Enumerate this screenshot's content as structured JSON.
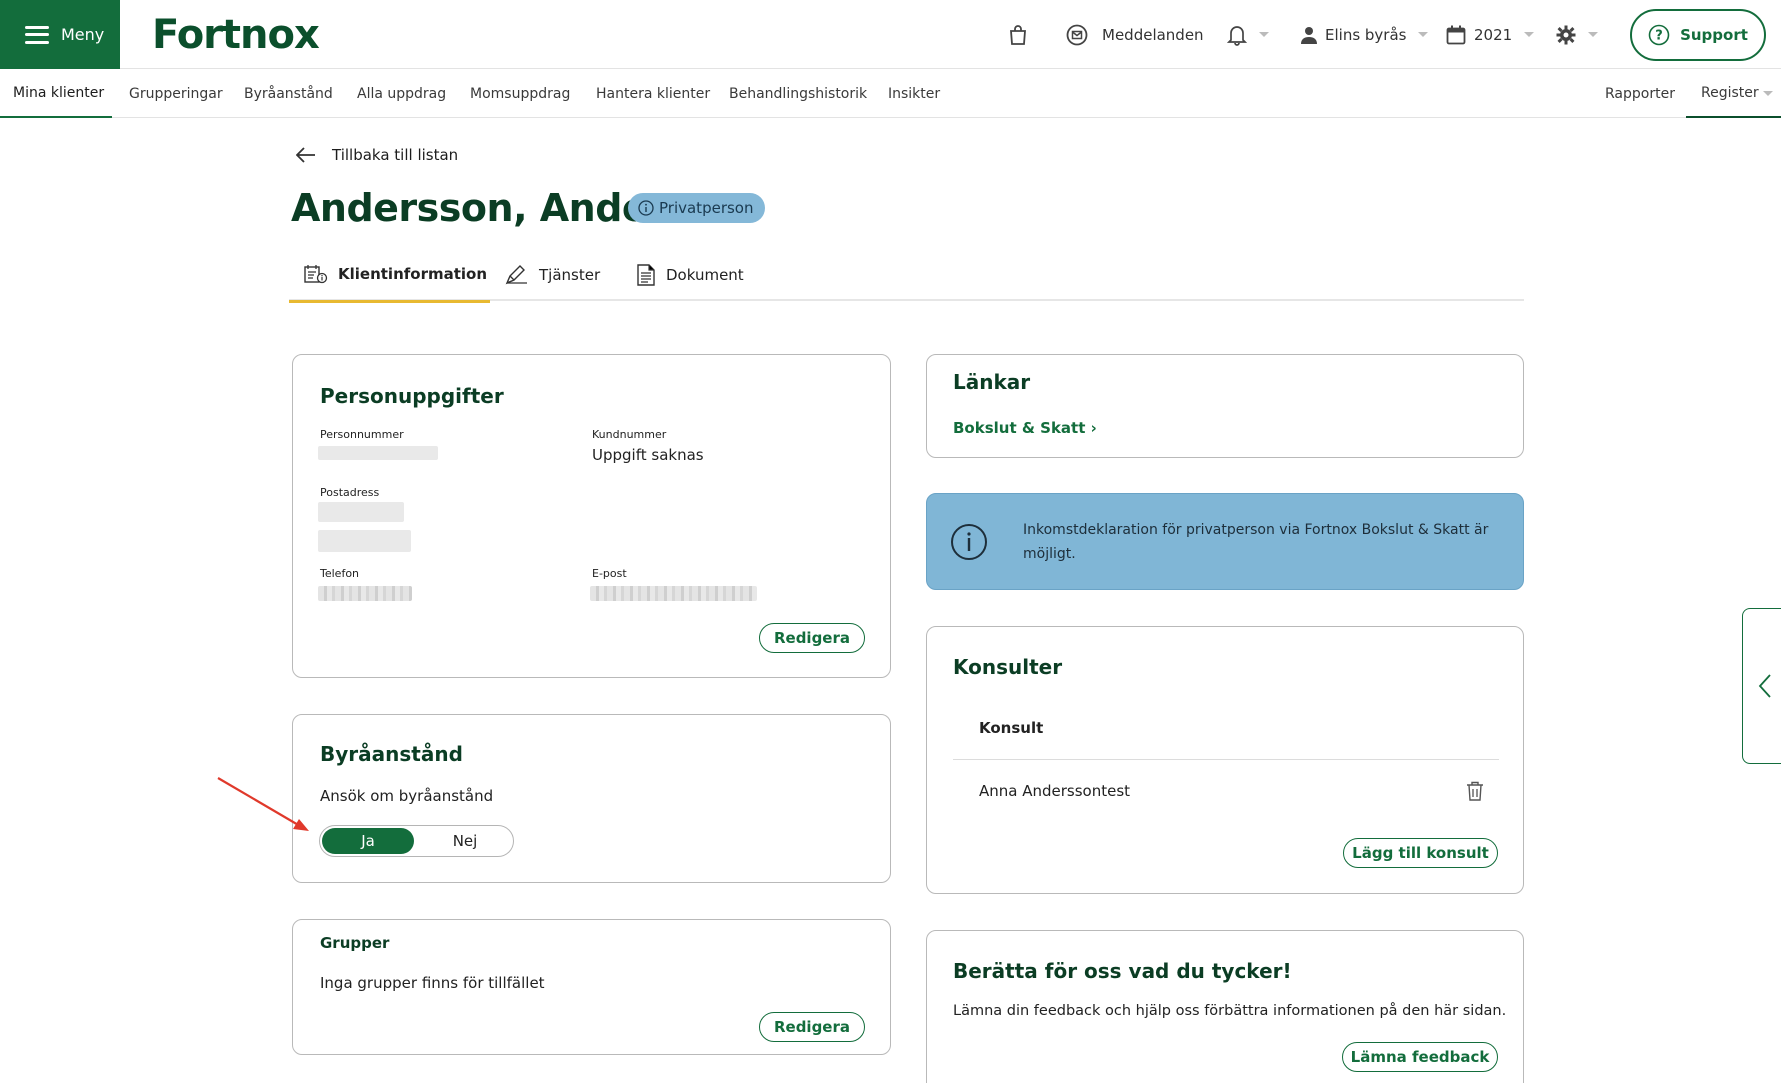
{
  "header": {
    "menu_label": "Meny",
    "logo_text": "Fortnox",
    "messages_label": "Meddelanden",
    "bureau_label": "Elins byrås",
    "year_label": "2021",
    "support_label": "Support",
    "icons": [
      "cart-icon",
      "message-icon",
      "bell-icon",
      "user-icon",
      "calendar-icon",
      "gear-icon",
      "help-icon"
    ]
  },
  "subnav": {
    "items": [
      "Mina klienter",
      "Grupperingar",
      "Byråanstånd",
      "Alla uppdrag",
      "Momsuppdrag",
      "Hantera klienter",
      "Behandlingshistorik",
      "Insikter"
    ],
    "active_item": "Mina klienter",
    "right_items": [
      "Rapporter",
      "Register"
    ]
  },
  "page": {
    "back_label": "Tillbaka till listan",
    "title": "Andersson, Anders",
    "badge": "Privatperson",
    "tabs": [
      "Klientinformation",
      "Tjänster",
      "Dokument"
    ],
    "active_tab": "Klientinformation"
  },
  "personuppgifter": {
    "title": "Personuppgifter",
    "personnummer_label": "Personnummer",
    "kundnummer_label": "Kundnummer",
    "kundnummer_value": "Uppgift saknas",
    "postadress_label": "Postadress",
    "telefon_label": "Telefon",
    "epost_label": "E-post",
    "edit_label": "Redigera"
  },
  "byraanstand": {
    "title": "Byråanstånd",
    "question": "Ansök om byråanstånd",
    "option_yes": "Ja",
    "option_no": "Nej",
    "selected": "Ja"
  },
  "grupper": {
    "title": "Grupper",
    "empty_text": "Inga grupper finns för tillfället",
    "edit_label": "Redigera"
  },
  "lankar": {
    "title": "Länkar",
    "link_label": "Bokslut & Skatt ›"
  },
  "info": {
    "text": "Inkomstdeklaration för privatperson via Fortnox Bokslut & Skatt är möjligt."
  },
  "konsulter": {
    "title": "Konsulter",
    "column_header": "Konsult",
    "rows": [
      "Anna Anderssontest"
    ],
    "add_label": "Lägg till konsult"
  },
  "feedback": {
    "title": "Berätta för oss vad du tycker!",
    "text": "Lämna din feedback och hjälp oss förbättra informationen på den här sidan.",
    "button_label": "Lämna feedback"
  },
  "colors": {
    "brand_green": "#136d3c",
    "dark_green": "#0b3d24",
    "info_blue": "#80b6d6",
    "tab_accent": "#e8b931",
    "annotation_red": "#e0392b"
  }
}
